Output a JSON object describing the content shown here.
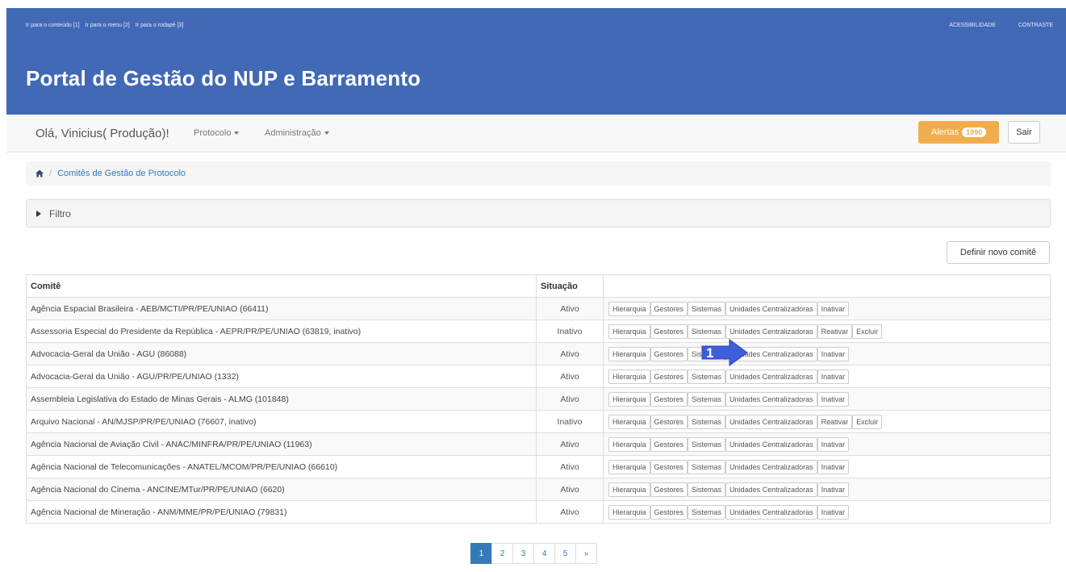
{
  "header": {
    "skip_links": [
      "Ir para o conteúdo [1]",
      "Ir para o menu [2]",
      "Ir para o rodapé [3]"
    ],
    "accessibility": "ACESSIBILIDADE",
    "contrast": "CONTRASTE",
    "title": "Portal de Gestão do NUP e Barramento"
  },
  "nav": {
    "greeting": "Olá, Vinicius( Produção)!",
    "menu_protocolo": "Protocolo",
    "menu_admin": "Administração",
    "alerts_label": "Alertas",
    "alerts_count": "1990",
    "logout": "Sair"
  },
  "breadcrumb": {
    "current": "Comitês de Gestão de Protocolo"
  },
  "filter": {
    "label": "Filtro"
  },
  "new_button": "Definir novo comitê",
  "table": {
    "headers": {
      "committee": "Comitê",
      "status": "Situação"
    },
    "rows": [
      {
        "name": "Agência Espacial Brasileira - AEB/MCTI/PR/PE/UNIAO (66411)",
        "status": "Ativo",
        "actions": [
          "Hierarquia",
          "Gestores",
          "Sistemas",
          "Unidades Centralizadoras",
          "Inativar"
        ]
      },
      {
        "name": "Assessoria Especial do Presidente da República - AEPR/PR/PE/UNIAO (63819, inativo)",
        "status": "Inativo",
        "actions": [
          "Hierarquia",
          "Gestores",
          "Sistemas",
          "Unidades Centralizadoras",
          "Reativar",
          "Excluir"
        ]
      },
      {
        "name": "Advocacia-Geral da União - AGU (86088)",
        "status": "Ativo",
        "actions": [
          "Hierarquia",
          "Gestores",
          "Sistemas",
          "Unidades Centralizadoras",
          "Inativar"
        ]
      },
      {
        "name": "Advocacia-Geral da União - AGU/PR/PE/UNIAO (1332)",
        "status": "Ativo",
        "actions": [
          "Hierarquia",
          "Gestores",
          "Sistemas",
          "Unidades Centralizadoras",
          "Inativar"
        ]
      },
      {
        "name": "Assembleia Legislativa do Estado de Minas Gerais - ALMG (101848)",
        "status": "Ativo",
        "actions": [
          "Hierarquia",
          "Gestores",
          "Sistemas",
          "Unidades Centralizadoras",
          "Inativar"
        ]
      },
      {
        "name": "Arquivo Nacional - AN/MJSP/PR/PE/UNIAO (76607, inativo)",
        "status": "Inativo",
        "actions": [
          "Hierarquia",
          "Gestores",
          "Sistemas",
          "Unidades Centralizadoras",
          "Reativar",
          "Excluir"
        ]
      },
      {
        "name": "Agência Nacional de Aviação Civil - ANAC/MINFRA/PR/PE/UNIAO (11963)",
        "status": "Ativo",
        "actions": [
          "Hierarquia",
          "Gestores",
          "Sistemas",
          "Unidades Centralizadoras",
          "Inativar"
        ]
      },
      {
        "name": "Agência Nacional de Telecomunicações - ANATEL/MCOM/PR/PE/UNIAO (66610)",
        "status": "Ativo",
        "actions": [
          "Hierarquia",
          "Gestores",
          "Sistemas",
          "Unidades Centralizadoras",
          "Inativar"
        ]
      },
      {
        "name": "Agência Nacional do Cinema - ANCINE/MTur/PR/PE/UNIAO (6620)",
        "status": "Ativo",
        "actions": [
          "Hierarquia",
          "Gestores",
          "Sistemas",
          "Unidades Centralizadoras",
          "Inativar"
        ]
      },
      {
        "name": "Agência Nacional de Mineração - ANM/MME/PR/PE/UNIAO (79831)",
        "status": "Ativo",
        "actions": [
          "Hierarquia",
          "Gestores",
          "Sistemas",
          "Unidades Centralizadoras",
          "Inativar"
        ]
      }
    ]
  },
  "pagination": {
    "pages": [
      "1",
      "2",
      "3",
      "4",
      "5",
      "»"
    ],
    "active": "1"
  },
  "callout": {
    "number": "1"
  },
  "colors": {
    "header_bg": "#4169b5",
    "alert_bg": "#f0ad4e",
    "link": "#337ab7",
    "callout": "#3d5fd9"
  }
}
